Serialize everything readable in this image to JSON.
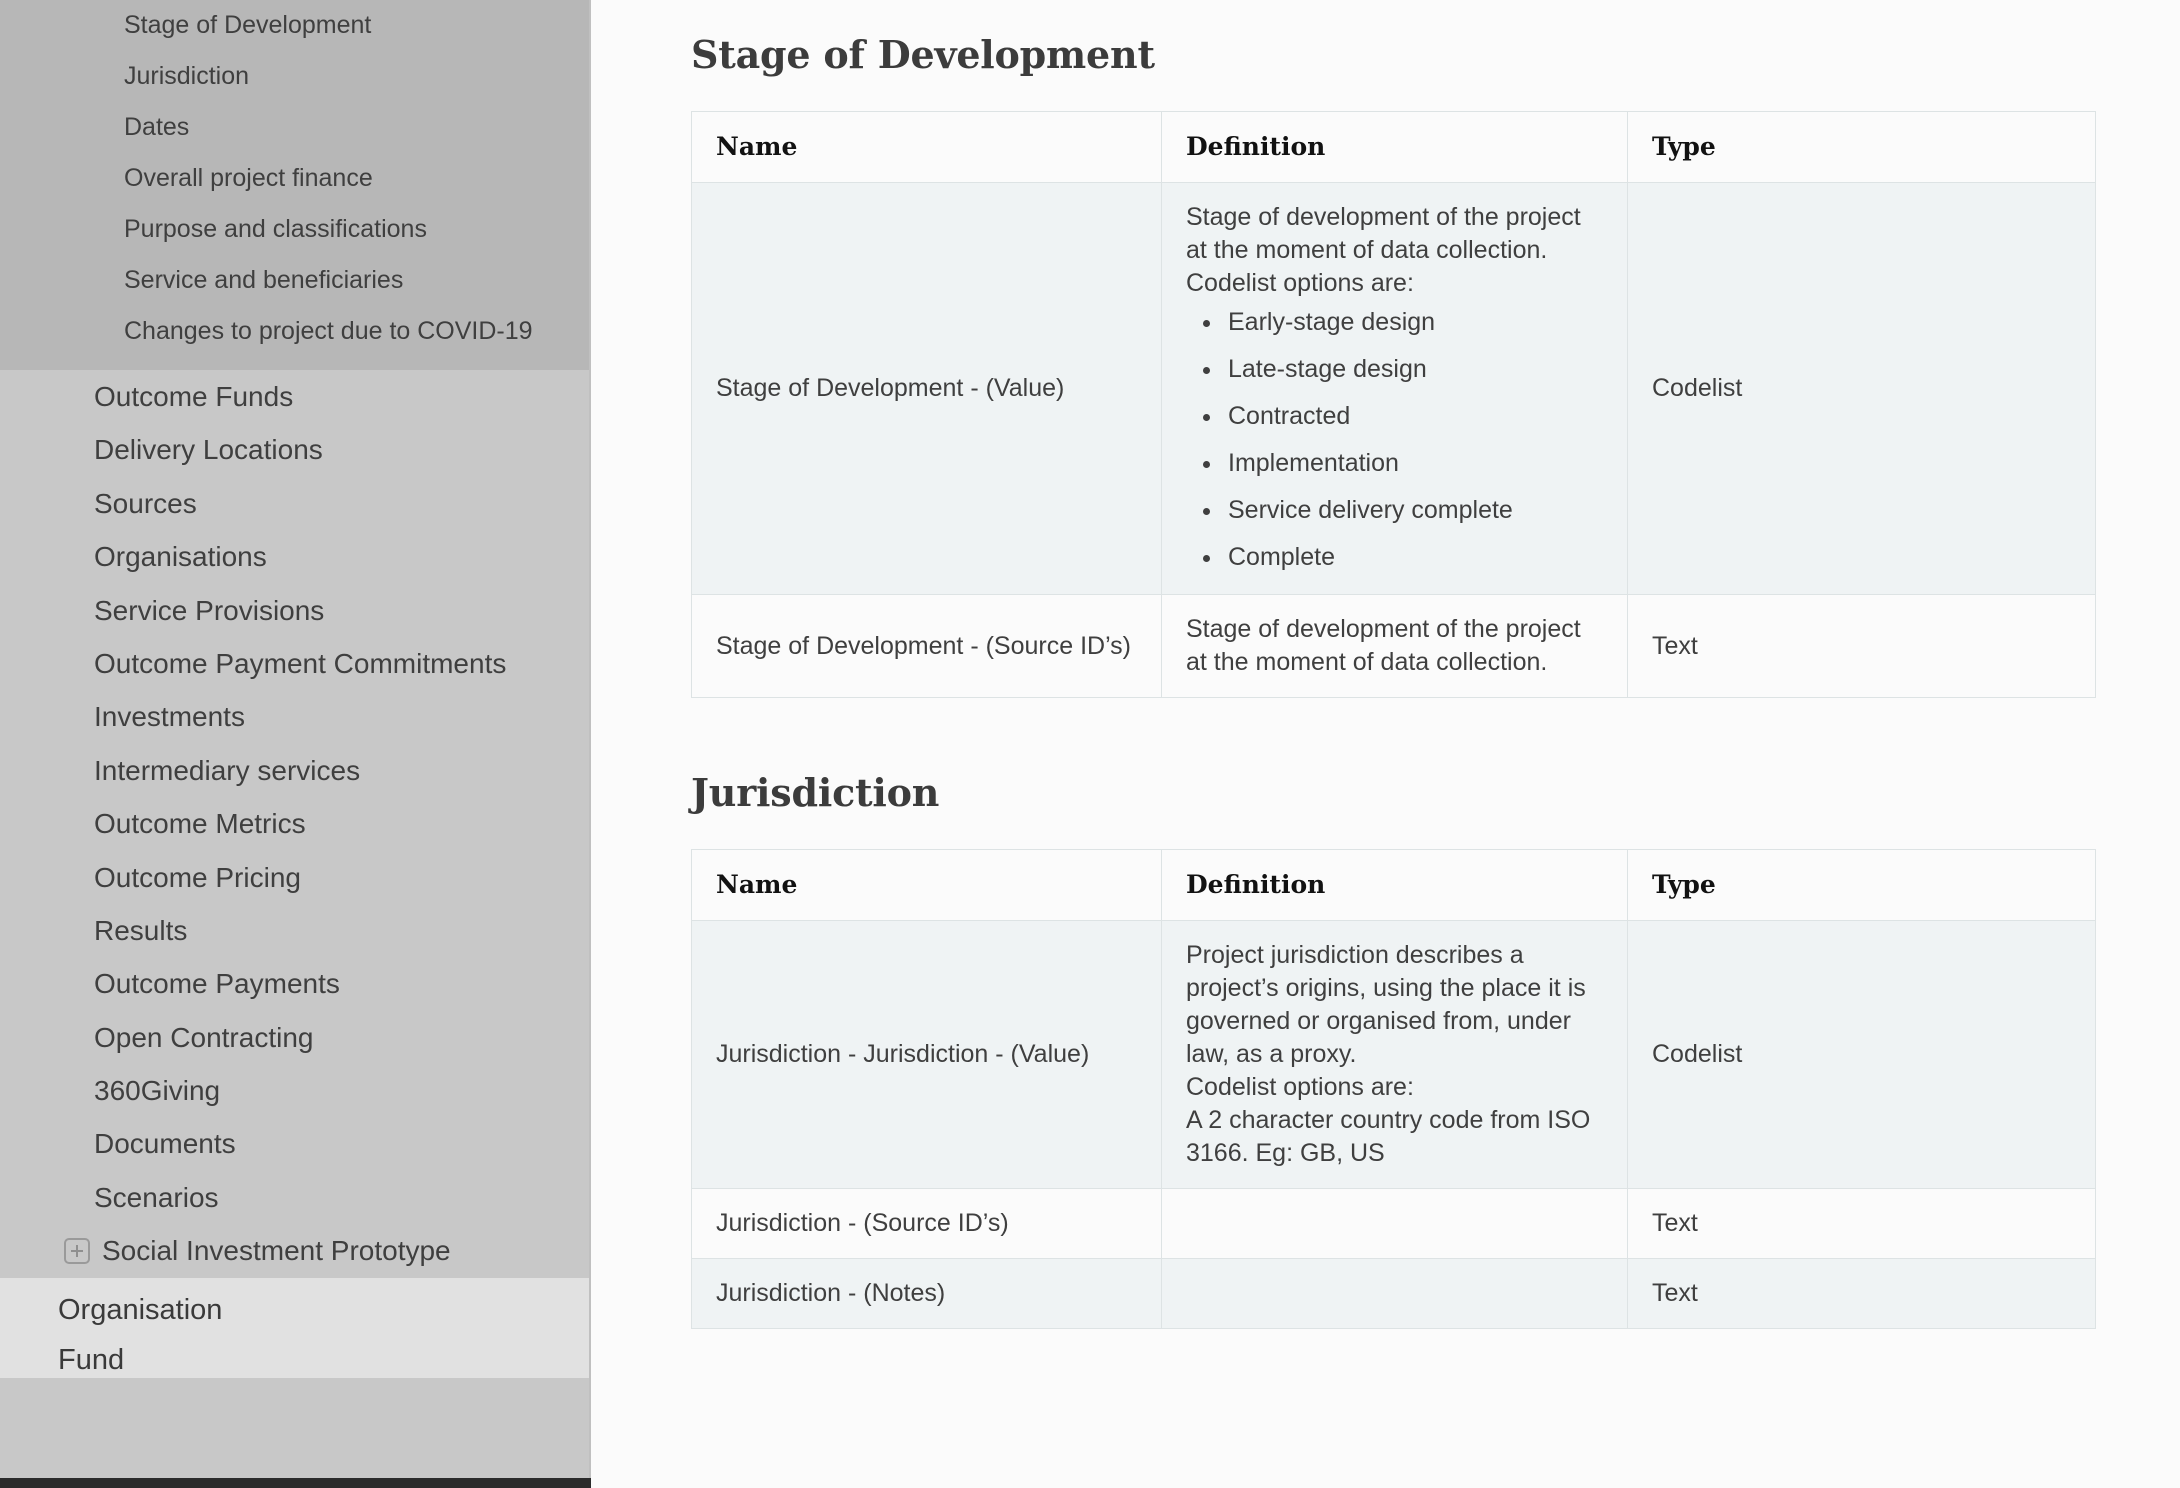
{
  "sidebar": {
    "sub_items": [
      {
        "label": "Stage of Development"
      },
      {
        "label": "Jurisdiction"
      },
      {
        "label": "Dates"
      },
      {
        "label": "Overall project finance"
      },
      {
        "label": "Purpose and classifications"
      },
      {
        "label": "Service and beneficiaries"
      },
      {
        "label": "Changes to project due to COVID-19"
      }
    ],
    "main_items": [
      {
        "label": "Outcome Funds",
        "toggle": false
      },
      {
        "label": "Delivery Locations",
        "toggle": false
      },
      {
        "label": "Sources",
        "toggle": false
      },
      {
        "label": "Organisations",
        "toggle": false
      },
      {
        "label": "Service Provisions",
        "toggle": false
      },
      {
        "label": "Outcome Payment Commitments",
        "toggle": false
      },
      {
        "label": "Investments",
        "toggle": false
      },
      {
        "label": "Intermediary services",
        "toggle": false
      },
      {
        "label": "Outcome Metrics",
        "toggle": false
      },
      {
        "label": "Outcome Pricing",
        "toggle": false
      },
      {
        "label": "Results",
        "toggle": false
      },
      {
        "label": "Outcome Payments",
        "toggle": false
      },
      {
        "label": "Open Contracting",
        "toggle": false
      },
      {
        "label": "360Giving",
        "toggle": false
      },
      {
        "label": "Documents",
        "toggle": false
      },
      {
        "label": "Scenarios",
        "toggle": false
      },
      {
        "label": "Social Investment Prototype",
        "toggle": true
      }
    ],
    "footer_items": [
      {
        "label": "Organisation"
      },
      {
        "label": "Fund"
      }
    ],
    "expand_icon": "plus-box-icon"
  },
  "main": {
    "sections": [
      {
        "title": "Stage of Development",
        "columns": [
          "Name",
          "Definition",
          "Type"
        ],
        "rows": [
          {
            "name": "Stage of Development - (Value)",
            "definition_paragraphs": [
              "Stage of development of the project at the moment of data collection.",
              "Codelist options are:"
            ],
            "definition_list": [
              "Early-stage design",
              "Late-stage design",
              "Contracted",
              "Implementation",
              "Service delivery complete",
              "Complete"
            ],
            "type": "Codelist"
          },
          {
            "name": "Stage of Development - (Source ID’s)",
            "definition_paragraphs": [
              "Stage of development of the project at the moment of data collection."
            ],
            "definition_list": [],
            "type": "Text"
          }
        ]
      },
      {
        "title": "Jurisdiction",
        "columns": [
          "Name",
          "Definition",
          "Type"
        ],
        "rows": [
          {
            "name": "Jurisdiction - Jurisdiction - (Value)",
            "definition_paragraphs": [
              "Project jurisdiction describes a project’s origins, using the place it is governed or organised from, under law, as a proxy.",
              "Codelist options are:",
              "A 2 character country code from ISO 3166. Eg: GB, US"
            ],
            "definition_list": [],
            "type": "Codelist"
          },
          {
            "name": "Jurisdiction - (Source ID’s)",
            "definition_paragraphs": [],
            "definition_list": [],
            "type": "Text"
          },
          {
            "name": "Jurisdiction - (Notes)",
            "definition_paragraphs": [],
            "definition_list": [],
            "type": "Text"
          }
        ]
      }
    ]
  },
  "colors": {
    "sidebar_sub_bg": "#b7b7b7",
    "sidebar_bg": "#c8c8c8",
    "sidebar_footer_bg": "#e1e1e1",
    "page_bg": "#fbfbfb",
    "row_stripe": "#eff3f4",
    "table_border": "#dde3e4",
    "heading": "#3c3c3c"
  }
}
